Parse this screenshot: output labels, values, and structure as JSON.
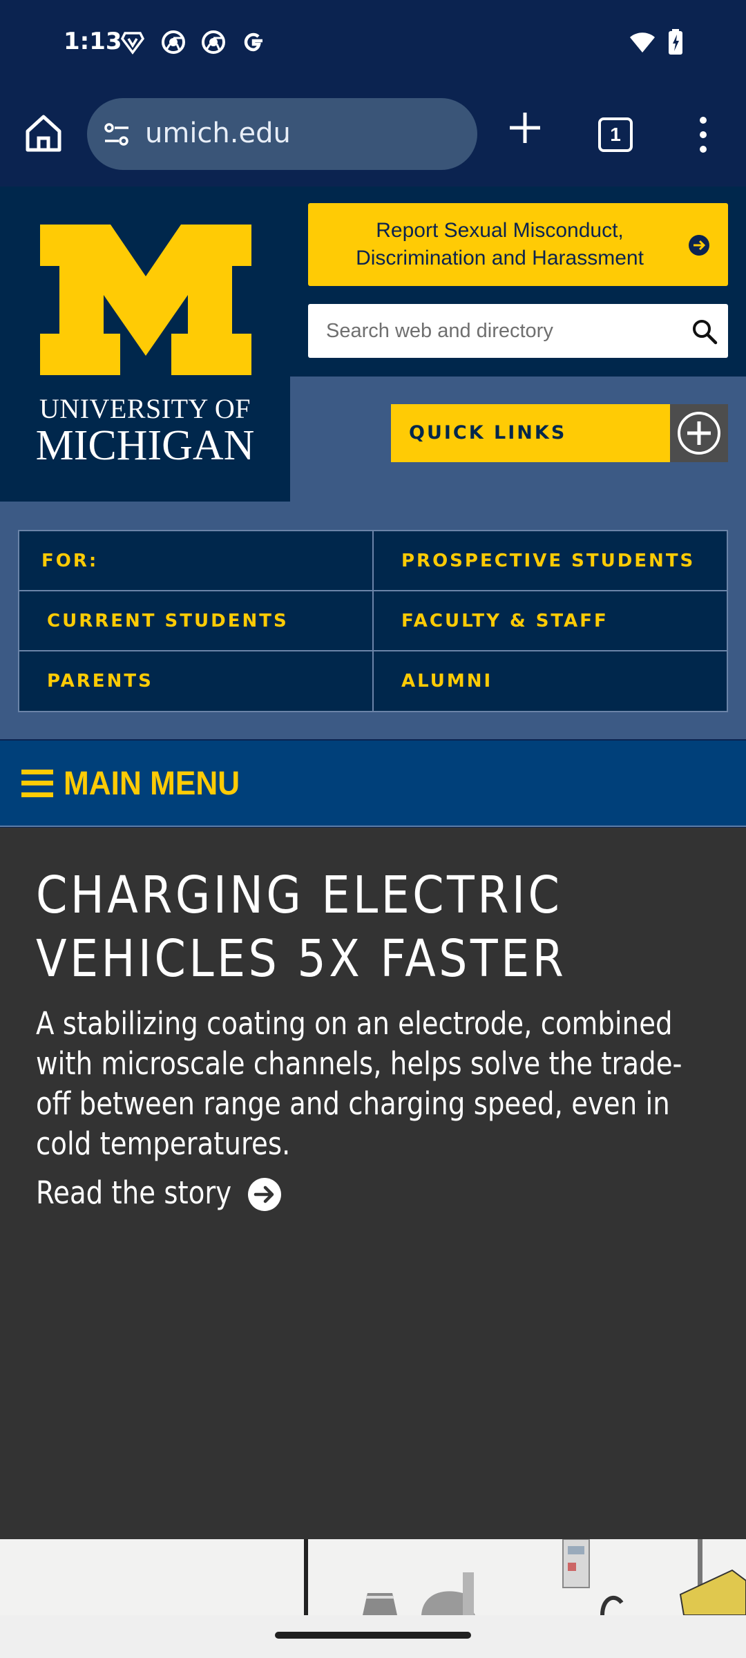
{
  "status_bar": {
    "time": "1:13",
    "icons": [
      "brave-icon",
      "chrome-icon",
      "chrome-icon",
      "google-icon",
      "wifi-icon",
      "battery-charging-icon"
    ]
  },
  "browser": {
    "url": "umich.edu",
    "tab_count": "1"
  },
  "header": {
    "logo_line1": "UNIVERSITY OF",
    "logo_line2": "MICHIGAN",
    "report_button": "Report Sexual Misconduct, Discrimination and Harassment",
    "search_placeholder": "Search web and directory",
    "quick_links": "QUICK LINKS"
  },
  "audience": {
    "cells": [
      "FOR:",
      "PROSPECTIVE STUDENTS",
      "CURRENT STUDENTS",
      "FACULTY & STAFF",
      "PARENTS",
      "ALUMNI"
    ]
  },
  "main_menu": {
    "label": "MAIN MENU"
  },
  "hero": {
    "title": "CHARGING ELECTRIC\nVEHICLES 5X FASTER",
    "description": "A stabilizing coating on an electrode, combined with microscale channels, helps solve the trade-off between range and charging speed, even in cold temperatures.",
    "link": "Read the story"
  },
  "colors": {
    "maize": "#ffcb05",
    "blue": "#00274c",
    "hero_bg": "#333333"
  }
}
